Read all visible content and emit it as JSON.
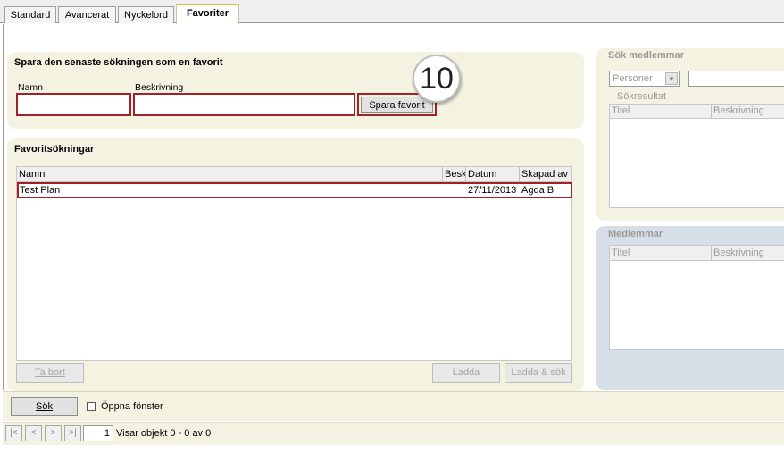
{
  "tabs": [
    {
      "label": "Standard"
    },
    {
      "label": "Avancerat"
    },
    {
      "label": "Nyckelord"
    },
    {
      "label": "Favoriter"
    }
  ],
  "save_section": {
    "title": "Spara den senaste sökningen som en favorit",
    "name_label": "Namn",
    "name_value": "",
    "description_label": "Beskrivning",
    "description_value": "",
    "save_button": "Spara favorit",
    "callout_number": "10"
  },
  "favorites": {
    "title": "Favoritsökningar",
    "columns": [
      "Namn",
      "Besk",
      "Datum",
      "Skapad av"
    ],
    "rows": [
      {
        "name": "Test Plan",
        "description": "",
        "date": "27/11/2013",
        "created_by": "Agda B"
      }
    ],
    "delete_button": "Ta bort",
    "load_button": "Ladda",
    "load_search_button": "Ladda & sök"
  },
  "search_members": {
    "title": "Sök medlemmar",
    "type_selected": "Personer",
    "search_value": "",
    "results_label": "Sökresultat",
    "columns": [
      "Titel",
      "Beskrivning"
    ]
  },
  "members": {
    "title": "Medlemmar",
    "columns": [
      "Titel",
      "Beskrivning"
    ]
  },
  "footer": {
    "search_button": "Sök",
    "open_window_label": "Öppna fönster",
    "open_window_checked": false,
    "pager_first": "|<",
    "pager_prev": "<",
    "pager_next": ">",
    "pager_last": ">|",
    "page_number": "1",
    "status": "Visar objekt 0 - 0 av 0"
  },
  "colors": {
    "panel_bg": "#f4f3e1",
    "members_panel_bg": "#d6dfe8",
    "highlight_red": "#a31f2a",
    "active_tab_accent": "#e7b73f"
  }
}
